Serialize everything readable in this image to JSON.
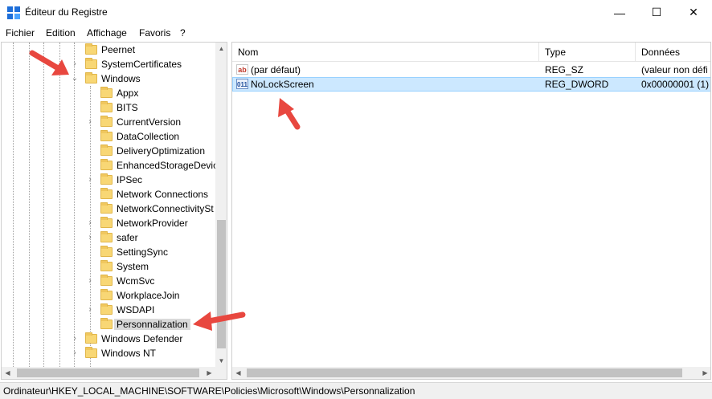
{
  "window": {
    "title": "Éditeur du Registre",
    "min_glyph": "—",
    "max_glyph": "☐",
    "close_glyph": "✕",
    "icon": "regedit-icon"
  },
  "menu": [
    "Fichier",
    "Edition",
    "Affichage",
    "Favoris",
    "?"
  ],
  "tree": {
    "items": [
      {
        "label": "Peernet",
        "expander": ""
      },
      {
        "label": "SystemCertificates",
        "expander": "›"
      },
      {
        "label": "Windows",
        "expander": "⌄"
      },
      {
        "label": "Appx",
        "expander": ""
      },
      {
        "label": "BITS",
        "expander": ""
      },
      {
        "label": "CurrentVersion",
        "expander": "›"
      },
      {
        "label": "DataCollection",
        "expander": ""
      },
      {
        "label": "DeliveryOptimization",
        "expander": ""
      },
      {
        "label": "EnhancedStorageDevic",
        "expander": ""
      },
      {
        "label": "IPSec",
        "expander": "›"
      },
      {
        "label": "Network Connections",
        "expander": ""
      },
      {
        "label": "NetworkConnectivitySt",
        "expander": ""
      },
      {
        "label": "NetworkProvider",
        "expander": "›"
      },
      {
        "label": "safer",
        "expander": "›"
      },
      {
        "label": "SettingSync",
        "expander": ""
      },
      {
        "label": "System",
        "expander": ""
      },
      {
        "label": "WcmSvc",
        "expander": "›"
      },
      {
        "label": "WorkplaceJoin",
        "expander": ""
      },
      {
        "label": "WSDAPI",
        "expander": "›"
      },
      {
        "label": "Personnalization",
        "expander": ""
      },
      {
        "label": "Windows Defender",
        "expander": "›"
      },
      {
        "label": "Windows NT",
        "expander": "›"
      }
    ],
    "selected": "Personnalization"
  },
  "list": {
    "columns": [
      "Nom",
      "Type",
      "Données"
    ],
    "rows": [
      {
        "icon": "ab",
        "name": "(par défaut)",
        "type": "REG_SZ",
        "data": "(valeur non défi"
      },
      {
        "icon": "011",
        "name": "NoLockScreen",
        "type": "REG_DWORD",
        "data": "0x00000001 (1)"
      }
    ]
  },
  "status": {
    "path": "Ordinateur\\HKEY_LOCAL_MACHINE\\SOFTWARE\\Policies\\Microsoft\\Windows\\Personnalization"
  },
  "colors": {
    "selection_bg": "#cce8ff",
    "selection_border": "#99d1ff",
    "folder": "#f8d775",
    "annotation_arrow": "#e8473f"
  }
}
